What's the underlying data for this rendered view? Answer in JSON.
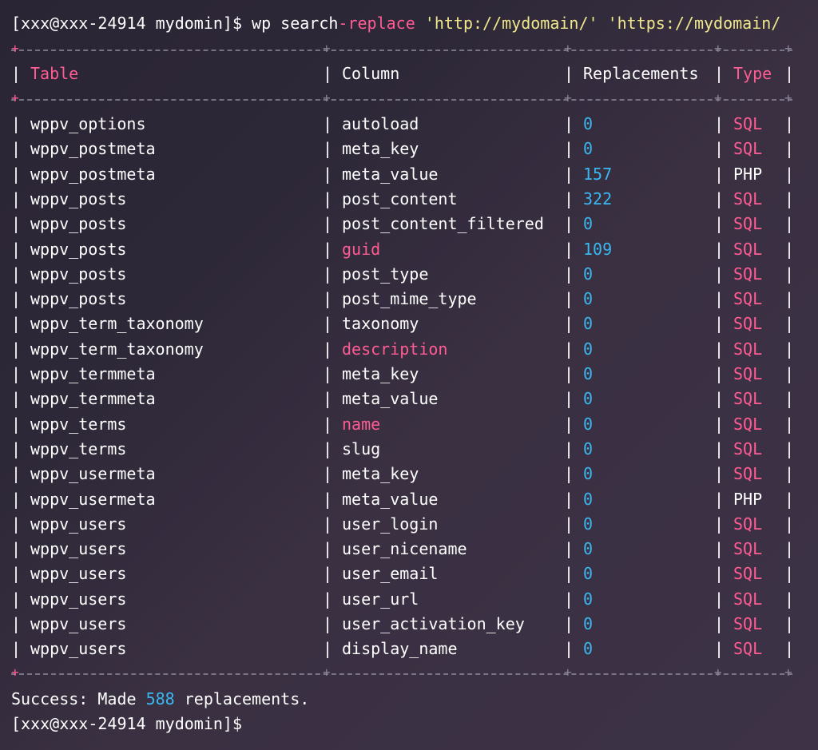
{
  "command": {
    "prompt": "[xxx@xxx-24914 mydomin]$",
    "cmd_start": "wp search",
    "cmd_pink": "-replace",
    "arg1": "'http://mydomain/'",
    "arg2": "'https://mydomain/"
  },
  "table": {
    "headers": {
      "table": "Table",
      "column": "Column",
      "replacements": "Replacements",
      "type": "Type"
    },
    "rows": [
      {
        "table": "wppv_options",
        "column": "autoload",
        "replacements": "0",
        "type": "SQL"
      },
      {
        "table": "wppv_postmeta",
        "column": "meta_key",
        "replacements": "0",
        "type": "SQL"
      },
      {
        "table": "wppv_postmeta",
        "column": "meta_value",
        "replacements": "157",
        "type": "PHP"
      },
      {
        "table": "wppv_posts",
        "column": "post_content",
        "replacements": "322",
        "type": "SQL"
      },
      {
        "table": "wppv_posts",
        "column": "post_content_filtered",
        "replacements": "0",
        "type": "SQL"
      },
      {
        "table": "wppv_posts",
        "column": "guid",
        "replacements": "109",
        "type": "SQL"
      },
      {
        "table": "wppv_posts",
        "column": "post_type",
        "replacements": "0",
        "type": "SQL"
      },
      {
        "table": "wppv_posts",
        "column": "post_mime_type",
        "replacements": "0",
        "type": "SQL"
      },
      {
        "table": "wppv_term_taxonomy",
        "column": "taxonomy",
        "replacements": "0",
        "type": "SQL"
      },
      {
        "table": "wppv_term_taxonomy",
        "column": "description",
        "replacements": "0",
        "type": "SQL"
      },
      {
        "table": "wppv_termmeta",
        "column": "meta_key",
        "replacements": "0",
        "type": "SQL"
      },
      {
        "table": "wppv_termmeta",
        "column": "meta_value",
        "replacements": "0",
        "type": "SQL"
      },
      {
        "table": "wppv_terms",
        "column": "name",
        "replacements": "0",
        "type": "SQL"
      },
      {
        "table": "wppv_terms",
        "column": "slug",
        "replacements": "0",
        "type": "SQL"
      },
      {
        "table": "wppv_usermeta",
        "column": "meta_key",
        "replacements": "0",
        "type": "SQL"
      },
      {
        "table": "wppv_usermeta",
        "column": "meta_value",
        "replacements": "0",
        "type": "PHP"
      },
      {
        "table": "wppv_users",
        "column": "user_login",
        "replacements": "0",
        "type": "SQL"
      },
      {
        "table": "wppv_users",
        "column": "user_nicename",
        "replacements": "0",
        "type": "SQL"
      },
      {
        "table": "wppv_users",
        "column": "user_email",
        "replacements": "0",
        "type": "SQL"
      },
      {
        "table": "wppv_users",
        "column": "user_url",
        "replacements": "0",
        "type": "SQL"
      },
      {
        "table": "wppv_users",
        "column": "user_activation_key",
        "replacements": "0",
        "type": "SQL"
      },
      {
        "table": "wppv_users",
        "column": "display_name",
        "replacements": "0",
        "type": "SQL"
      }
    ],
    "pink_columns": [
      "guid",
      "description",
      "name"
    ]
  },
  "result": {
    "prefix": "Success: Made ",
    "count": "588",
    "suffix": " replacements."
  },
  "final_prompt": "[xxx@xxx-24914 mydomin]$",
  "colors": {
    "pink": "#ff5c93",
    "blue": "#39b8f0",
    "yellow": "#f0e68c",
    "dash": "#8a8598"
  }
}
